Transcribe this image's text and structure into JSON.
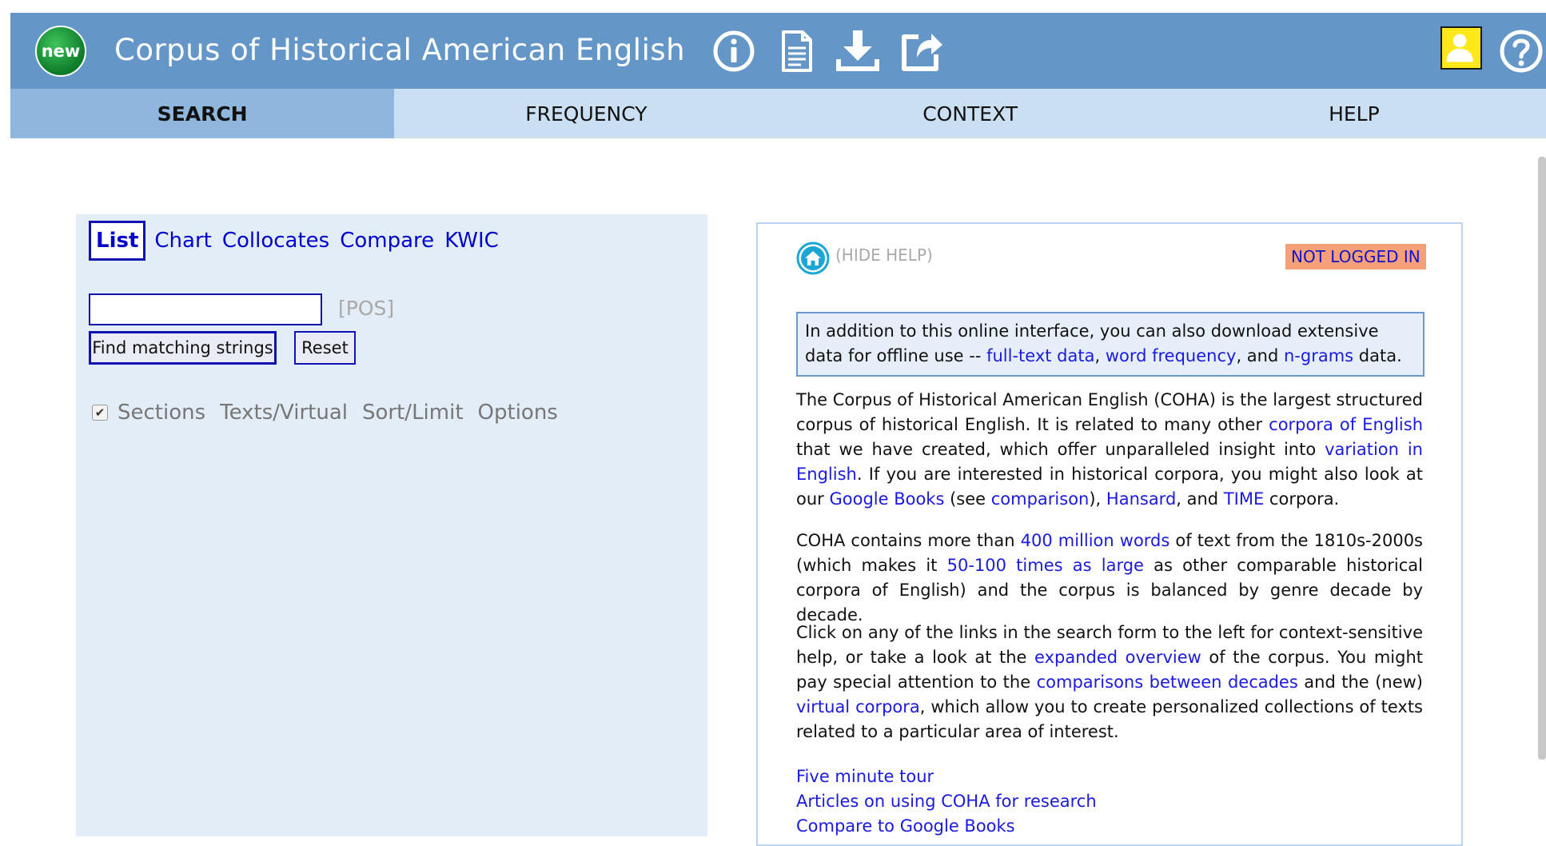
{
  "header": {
    "new_badge": "new",
    "title": "Corpus of Historical American English",
    "icons": [
      "info-icon",
      "document-icon",
      "download-icon",
      "external-link-icon",
      "user-icon",
      "help-icon"
    ],
    "colors": {
      "header_bg": "#6497c8",
      "tabs_bg": "#cbdff2",
      "active_tab_bg": "#8fb7de"
    }
  },
  "tabs": [
    {
      "label": "SEARCH",
      "active": true
    },
    {
      "label": "FREQUENCY",
      "active": false
    },
    {
      "label": "CONTEXT",
      "active": false
    },
    {
      "label": "HELP",
      "active": false
    }
  ],
  "search": {
    "modes": [
      {
        "label": "List",
        "active": true
      },
      {
        "label": "Chart"
      },
      {
        "label": "Collocates"
      },
      {
        "label": "Compare"
      },
      {
        "label": "KWIC"
      }
    ],
    "input_value": "",
    "pos_label": "[POS]",
    "find_label": "Find matching strings",
    "reset_label": "Reset",
    "options_checked": true,
    "options": [
      "Sections",
      "Texts/Virtual",
      "Sort/Limit",
      "Options"
    ]
  },
  "help": {
    "hide_help": "(HIDE HELP)",
    "login_status": "NOT LOGGED IN",
    "notice": {
      "t1": "In addition to this online interface, you can also download extensive data for offline use -- ",
      "l1": "full-text data",
      "t2": ", ",
      "l2": "word frequency",
      "t3": ", and ",
      "l3": "n-grams",
      "t4": " data."
    },
    "p1": {
      "t1": "The Corpus of Historical American English (COHA) is the largest structured corpus of historical English. It is related to many other ",
      "l1": "corpora of English",
      "t2": " that we have created, which offer unparalleled insight into ",
      "l2": "variation in English",
      "t3": ". If you are interested in historical corpora, you might also look at our ",
      "l3": "Google Books",
      "t4": " (see ",
      "l4": "comparison",
      "t5": "), ",
      "l5": "Hansard",
      "t6": ", and ",
      "l6": "TIME",
      "t7": " corpora."
    },
    "p2": {
      "t1": "COHA contains more than ",
      "l1": "400 million words",
      "t2": " of text from the 1810s-2000s (which makes it ",
      "l2": "50-100 times as large",
      "t3": " as other comparable historical corpora of English) and the corpus is balanced by genre decade by decade."
    },
    "p3": {
      "t1": "Click on any of the links in the search form to the left for context-sensitive help, or take a look at the ",
      "l1": "expanded overview",
      "t2": " of the corpus. You might pay special attention to the ",
      "l2": "comparisons between decades",
      "t3": " and the (new) ",
      "l3": "virtual corpora",
      "t4": ", which allow you to create personalized collections of texts related to a particular area of interest."
    },
    "links": [
      "Five minute tour",
      "Articles on using COHA for research",
      "Compare to Google Books"
    ]
  }
}
